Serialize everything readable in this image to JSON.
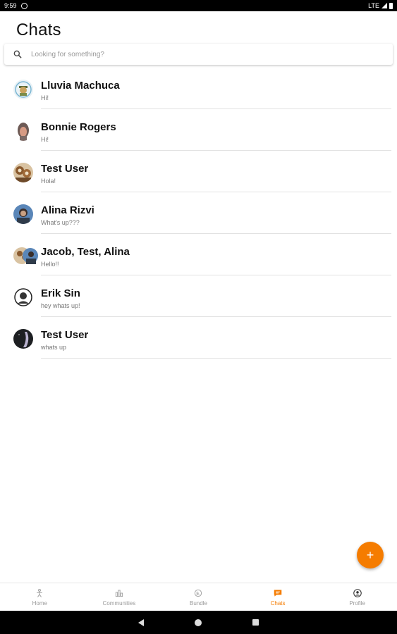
{
  "status_bar": {
    "time": "9:59",
    "network": "LTE"
  },
  "header": {
    "title": "Chats"
  },
  "search": {
    "placeholder": "Looking for something?"
  },
  "chats": [
    {
      "name": "Lluvia Machuca",
      "preview": "Hi!"
    },
    {
      "name": "Bonnie Rogers",
      "preview": "Hi!"
    },
    {
      "name": "Test User",
      "preview": "Hola!"
    },
    {
      "name": "Alina Rizvi",
      "preview": "What's up???"
    },
    {
      "name": "Jacob, Test, Alina",
      "preview": "Hello!!"
    },
    {
      "name": "Erik Sin",
      "preview": "hey whats up!"
    },
    {
      "name": "Test User",
      "preview": "whats up"
    }
  ],
  "fab": {
    "label": "+"
  },
  "bottom_nav": [
    {
      "label": "Home",
      "icon": "person-icon"
    },
    {
      "label": "Communities",
      "icon": "communities-icon"
    },
    {
      "label": "Bundle",
      "icon": "bundle-icon"
    },
    {
      "label": "Chats",
      "icon": "chat-icon",
      "active": true
    },
    {
      "label": "Profile",
      "icon": "profile-icon"
    }
  ],
  "colors": {
    "accent": "#f57c00",
    "text": "#111111",
    "muted": "#777777"
  }
}
